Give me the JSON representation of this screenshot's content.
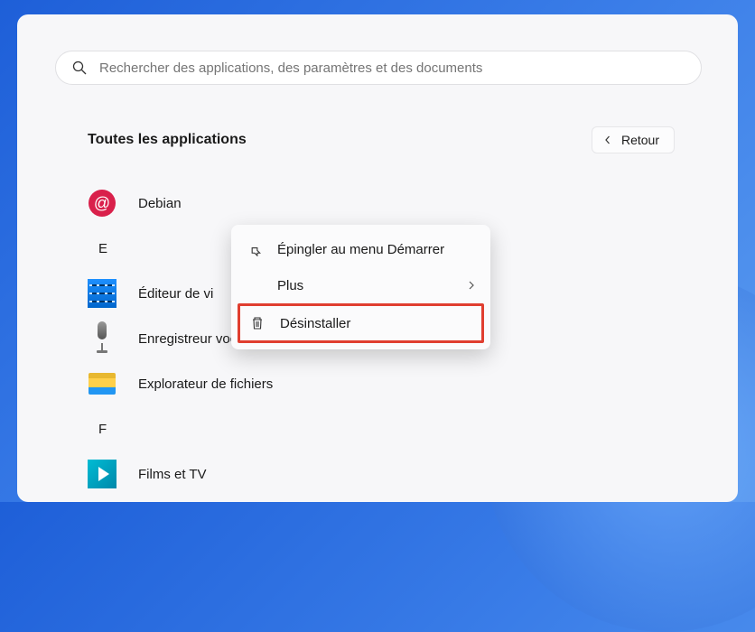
{
  "search": {
    "placeholder": "Rechercher des applications, des paramètres et des documents"
  },
  "header": {
    "title": "Toutes les applications",
    "back_label": "Retour"
  },
  "apps": {
    "debian": "Debian",
    "editeur": "Éditeur de vi",
    "enregistreur": "Enregistreur vocal",
    "explorateur": "Explorateur de fichiers",
    "films": "Films et TV"
  },
  "letters": {
    "e": "E",
    "f": "F"
  },
  "context_menu": {
    "pin": "Épingler au menu Démarrer",
    "more": "Plus",
    "uninstall": "Désinstaller"
  }
}
